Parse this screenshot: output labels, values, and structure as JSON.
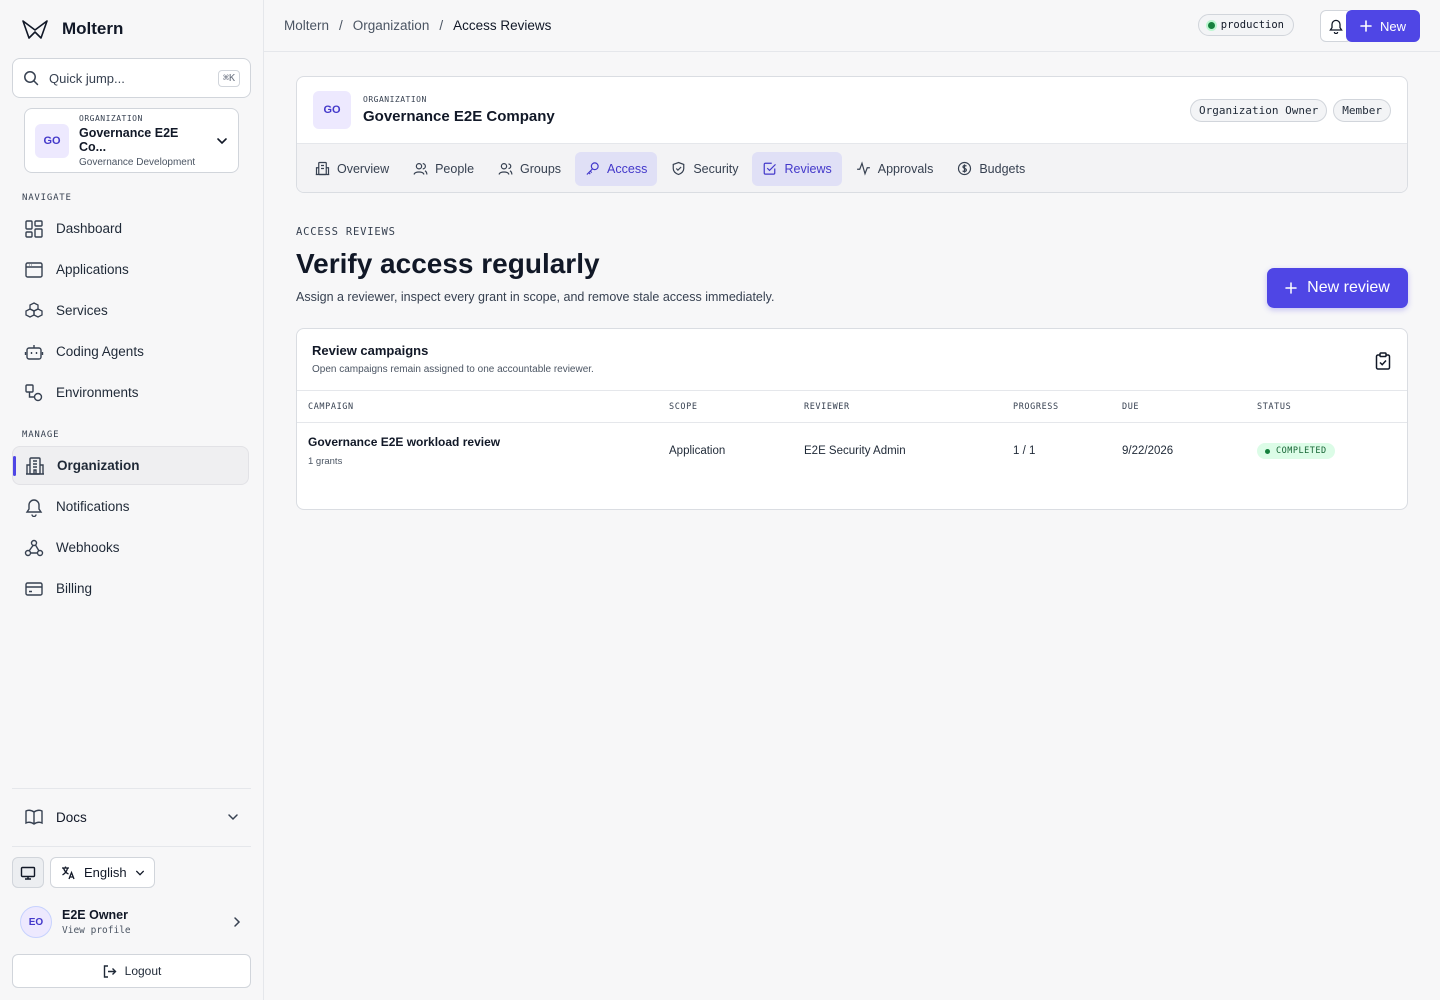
{
  "app": {
    "name": "Moltern"
  },
  "search": {
    "placeholder": "Quick jump...",
    "shortcut": "⌘K"
  },
  "org_selector": {
    "initials": "GO",
    "label": "ORGANIZATION",
    "name": "Governance E2E Co...",
    "subtitle": "Governance Development"
  },
  "sidebar": {
    "navigate_label": "NAVIGATE",
    "navigate": [
      {
        "label": "Dashboard",
        "icon": "dashboard-icon"
      },
      {
        "label": "Applications",
        "icon": "window-icon"
      },
      {
        "label": "Services",
        "icon": "boxes-icon"
      },
      {
        "label": "Coding Agents",
        "icon": "bot-icon"
      },
      {
        "label": "Environments",
        "icon": "shapes-icon"
      }
    ],
    "manage_label": "MANAGE",
    "manage": [
      {
        "label": "Organization",
        "icon": "building-icon",
        "active": true
      },
      {
        "label": "Notifications",
        "icon": "bell-icon"
      },
      {
        "label": "Webhooks",
        "icon": "webhook-icon"
      },
      {
        "label": "Billing",
        "icon": "credit-card-icon"
      }
    ],
    "docs_label": "Docs",
    "language": "English",
    "user": {
      "initials": "EO",
      "name": "E2E Owner",
      "action": "View profile"
    },
    "logout_label": "Logout"
  },
  "topbar": {
    "breadcrumbs": [
      "Moltern",
      "Organization",
      "Access Reviews"
    ],
    "environment": "production",
    "new_label": "New"
  },
  "org_card": {
    "initials": "GO",
    "label": "ORGANIZATION",
    "name": "Governance E2E Company",
    "roles": [
      "Organization Owner",
      "Member"
    ],
    "tabs": [
      {
        "label": "Overview",
        "icon": "building-icon"
      },
      {
        "label": "People",
        "icon": "users-icon"
      },
      {
        "label": "Groups",
        "icon": "group-icon"
      },
      {
        "label": "Access",
        "icon": "key-icon",
        "highlight": true
      },
      {
        "label": "Security",
        "icon": "shield-icon"
      },
      {
        "label": "Reviews",
        "icon": "check-square-icon",
        "highlight": true
      },
      {
        "label": "Approvals",
        "icon": "activity-icon"
      },
      {
        "label": "Budgets",
        "icon": "dollar-icon"
      }
    ]
  },
  "page": {
    "eyebrow": "ACCESS REVIEWS",
    "title": "Verify access regularly",
    "description": "Assign a reviewer, inspect every grant in scope, and remove stale access immediately.",
    "new_review_label": "New review"
  },
  "campaigns": {
    "title": "Review campaigns",
    "subtitle": "Open campaigns remain assigned to one accountable reviewer.",
    "columns": [
      "CAMPAIGN",
      "SCOPE",
      "REVIEWER",
      "PROGRESS",
      "DUE",
      "STATUS"
    ],
    "rows": [
      {
        "name": "Governance E2E workload review",
        "grants": "1 grants",
        "scope": "Application",
        "reviewer": "E2E Security Admin",
        "progress": "1 / 1",
        "due": "9/22/2026",
        "status": "COMPLETED"
      }
    ]
  },
  "colors": {
    "accent": "#4f46e5",
    "status_completed": "#166534",
    "status_completed_bg": "#dcfce7"
  }
}
